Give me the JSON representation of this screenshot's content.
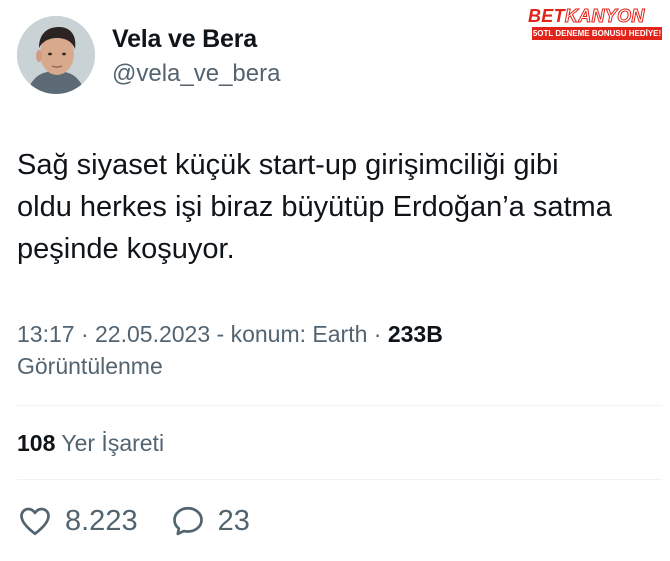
{
  "user": {
    "display_name": "Vela ve Bera",
    "handle": "@vela_ve_bera",
    "avatar_icon": "profile-photo"
  },
  "watermark": {
    "brand_part1": "BET",
    "brand_part2": "KANYON",
    "tagline": "5OTL DENEME BONUSU HEDİYE!",
    "color": "#e2231a"
  },
  "tweet": {
    "lines": [
      "Sağ siyaset küçük start-up girişimciliği gibi",
      "oldu herkes işi biraz büyütüp Erdoğan’a satma",
      "peşinde koşuyor."
    ]
  },
  "meta": {
    "time": "13:17",
    "date": "22.05.2023",
    "location": "konum: Earth",
    "views_count": "233B",
    "views_label": "Görüntülenme"
  },
  "bookmarks": {
    "count": "108",
    "label": "Yer İşareti"
  },
  "actions": {
    "likes": "8.223",
    "replies": "23",
    "like_icon": "heart-icon",
    "reply_icon": "speech-bubble-icon"
  }
}
